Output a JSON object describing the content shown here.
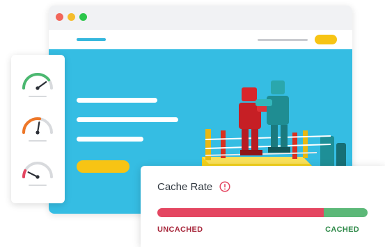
{
  "colors": {
    "window_red": "#f2665a",
    "window_yellow": "#f5bd2c",
    "window_green": "#2cc64a",
    "nav_accent": "#35b7dd",
    "pill_yellow": "#f7c414",
    "hero_bg": "#35bde3",
    "gauge_green": "#4bb870",
    "gauge_orange": "#ee7728",
    "gauge_red": "#e44661",
    "gauge_track": "#d8dadd",
    "uncached": "#e44661",
    "cached": "#5cb878",
    "uncached_text": "#a8283c",
    "cached_text": "#2f8a49"
  },
  "gauges": [
    {
      "name": "speed-gauge-good",
      "level": 0.8
    },
    {
      "name": "speed-gauge-medium",
      "level": 0.55
    },
    {
      "name": "speed-gauge-poor",
      "level": 0.15
    }
  ],
  "cache_card": {
    "title": "Cache Rate",
    "alert_icon": "alert-circle-icon",
    "uncached_fraction": 0.79,
    "cached_fraction": 0.21,
    "uncached_label": "UNCACHED",
    "cached_label": "CACHED"
  },
  "hero": {
    "image": "robots-boxing-toy-photo"
  }
}
